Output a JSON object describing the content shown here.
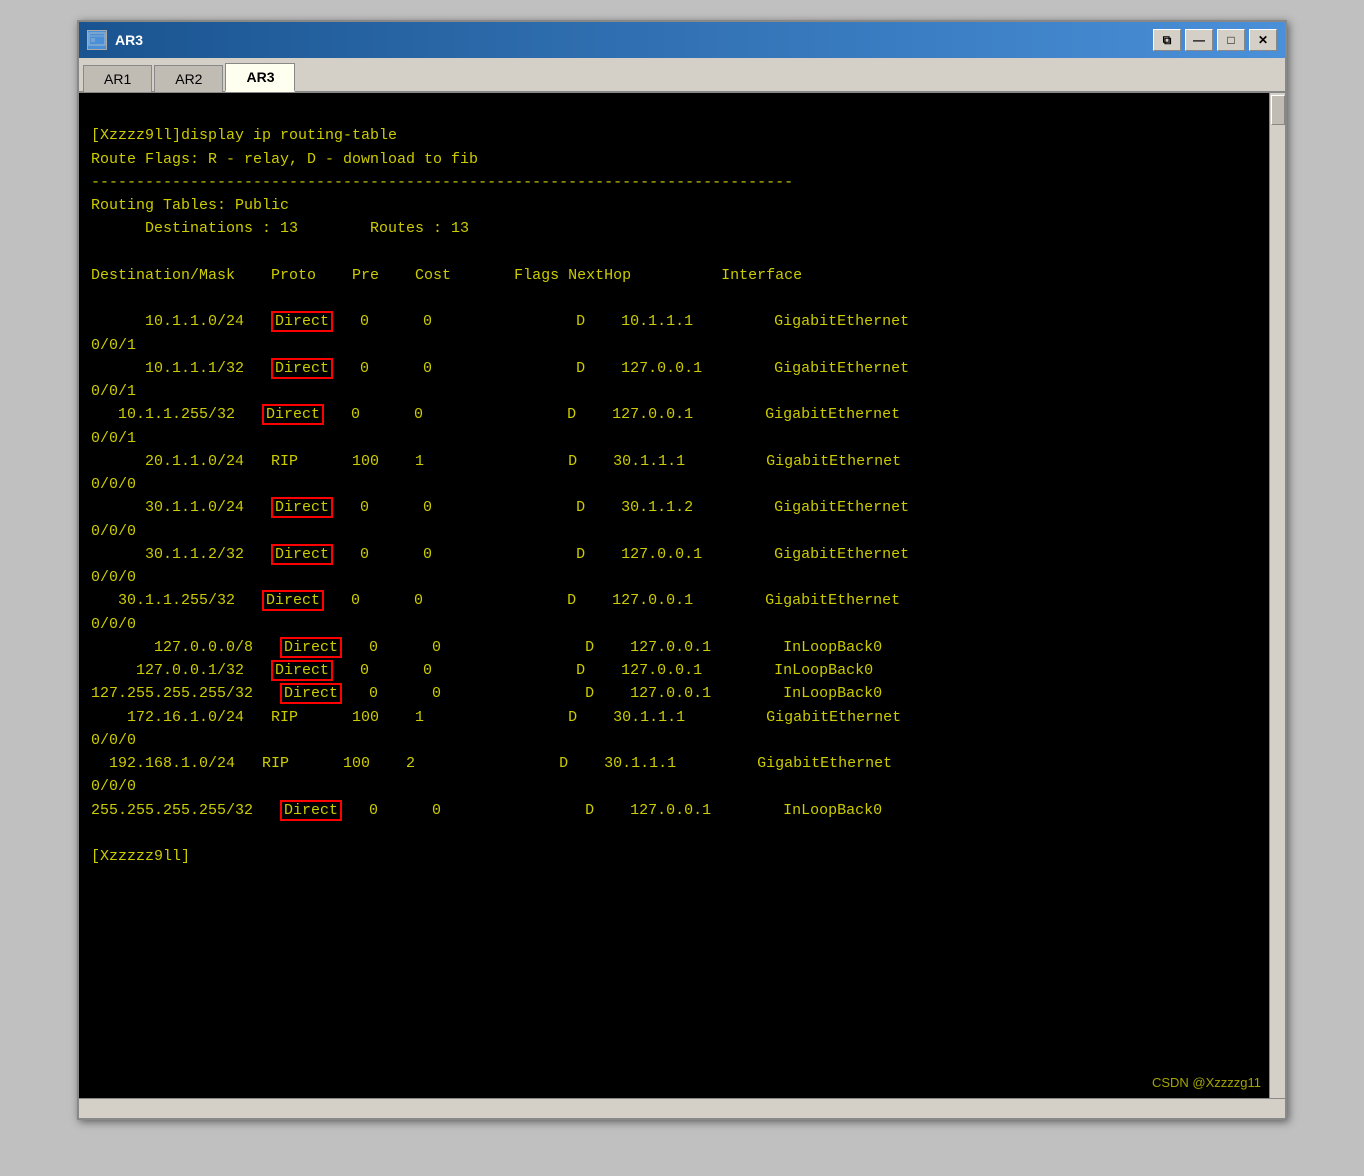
{
  "window": {
    "title": "AR3",
    "icon": "AR",
    "tabs": [
      {
        "label": "AR1",
        "active": false
      },
      {
        "label": "AR2",
        "active": false
      },
      {
        "label": "AR3",
        "active": true
      }
    ],
    "controls": [
      "🗗",
      "—",
      "□",
      "✕"
    ]
  },
  "terminal": {
    "prompt_line1": "[Xzzzz9ll]display ip routing-table",
    "prompt_line2": "Route Flags: R - relay, D - download to fib",
    "separator": "------------------------------------------------------------------------------",
    "routing_tables_label": "Routing Tables: Public",
    "destinations_label": "      Destinations : 13",
    "routes_label": "    Routes : 13",
    "header": "Destination/Mask    Proto    Pre    Cost       Flags NextHop          Interface",
    "routes": [
      {
        "dest": "      10.1.1.0/24",
        "proto": "Direct",
        "pre": "0",
        "cost": "0",
        "flags": "D",
        "nexthop": "10.1.1.1",
        "interface": "GigabitEthernet",
        "iface2": "0/0/1",
        "highlighted": true
      },
      {
        "dest": "      10.1.1.1/32",
        "proto": "Direct",
        "pre": "0",
        "cost": "0",
        "flags": "D",
        "nexthop": "127.0.0.1",
        "interface": "GigabitEthernet",
        "iface2": "0/0/1",
        "highlighted": true
      },
      {
        "dest": "   10.1.1.255/32",
        "proto": "Direct",
        "pre": "0",
        "cost": "0",
        "flags": "D",
        "nexthop": "127.0.0.1",
        "interface": "GigabitEthernet",
        "iface2": "0/0/1",
        "highlighted": true
      },
      {
        "dest": "      20.1.1.0/24",
        "proto": "RIP",
        "pre": "100",
        "cost": "1",
        "flags": "D",
        "nexthop": "30.1.1.1",
        "interface": "GigabitEthernet",
        "iface2": "0/0/0",
        "highlighted": false
      },
      {
        "dest": "      30.1.1.0/24",
        "proto": "Direct",
        "pre": "0",
        "cost": "0",
        "flags": "D",
        "nexthop": "30.1.1.2",
        "interface": "GigabitEthernet",
        "iface2": "0/0/0",
        "highlighted": true
      },
      {
        "dest": "      30.1.1.2/32",
        "proto": "Direct",
        "pre": "0",
        "cost": "0",
        "flags": "D",
        "nexthop": "127.0.0.1",
        "interface": "GigabitEthernet",
        "iface2": "0/0/0",
        "highlighted": true
      },
      {
        "dest": "   30.1.1.255/32",
        "proto": "Direct",
        "pre": "0",
        "cost": "0",
        "flags": "D",
        "nexthop": "127.0.0.1",
        "interface": "GigabitEthernet",
        "iface2": "0/0/0",
        "highlighted": true
      },
      {
        "dest": "       127.0.0.0/8",
        "proto": "Direct",
        "pre": "0",
        "cost": "0",
        "flags": "D",
        "nexthop": "127.0.0.1",
        "interface": "InLoopBack0",
        "iface2": "",
        "highlighted": true
      },
      {
        "dest": "     127.0.0.1/32",
        "proto": "Direct",
        "pre": "0",
        "cost": "0",
        "flags": "D",
        "nexthop": "127.0.0.1",
        "interface": "InLoopBack0",
        "iface2": "",
        "highlighted": true
      },
      {
        "dest": "127.255.255.255/32",
        "proto": "Direct",
        "pre": "0",
        "cost": "0",
        "flags": "D",
        "nexthop": "127.0.0.1",
        "interface": "InLoopBack0",
        "iface2": "",
        "highlighted": true
      },
      {
        "dest": "    172.16.1.0/24",
        "proto": "RIP",
        "pre": "100",
        "cost": "1",
        "flags": "D",
        "nexthop": "30.1.1.1",
        "interface": "GigabitEthernet",
        "iface2": "0/0/0",
        "highlighted": false
      },
      {
        "dest": "  192.168.1.0/24",
        "proto": "RIP",
        "pre": "100",
        "cost": "2",
        "flags": "D",
        "nexthop": "30.1.1.1",
        "interface": "GigabitEthernet",
        "iface2": "0/0/0",
        "highlighted": false
      },
      {
        "dest": "255.255.255.255/32",
        "proto": "Direct",
        "pre": "0",
        "cost": "0",
        "flags": "D",
        "nexthop": "127.0.0.1",
        "interface": "InLoopBack0",
        "iface2": "",
        "highlighted": true
      }
    ],
    "final_prompt": "[Xzzzzz9ll]",
    "watermark": "CSDN @Xzzzzg11"
  },
  "colors": {
    "terminal_bg": "#000000",
    "terminal_text": "#cccc00",
    "highlight_border": "#ff0000",
    "title_bar_start": "#1a5490",
    "title_bar_end": "#4a90d9",
    "tab_active_bg": "#fffff0",
    "window_bg": "#d4d0c8"
  }
}
